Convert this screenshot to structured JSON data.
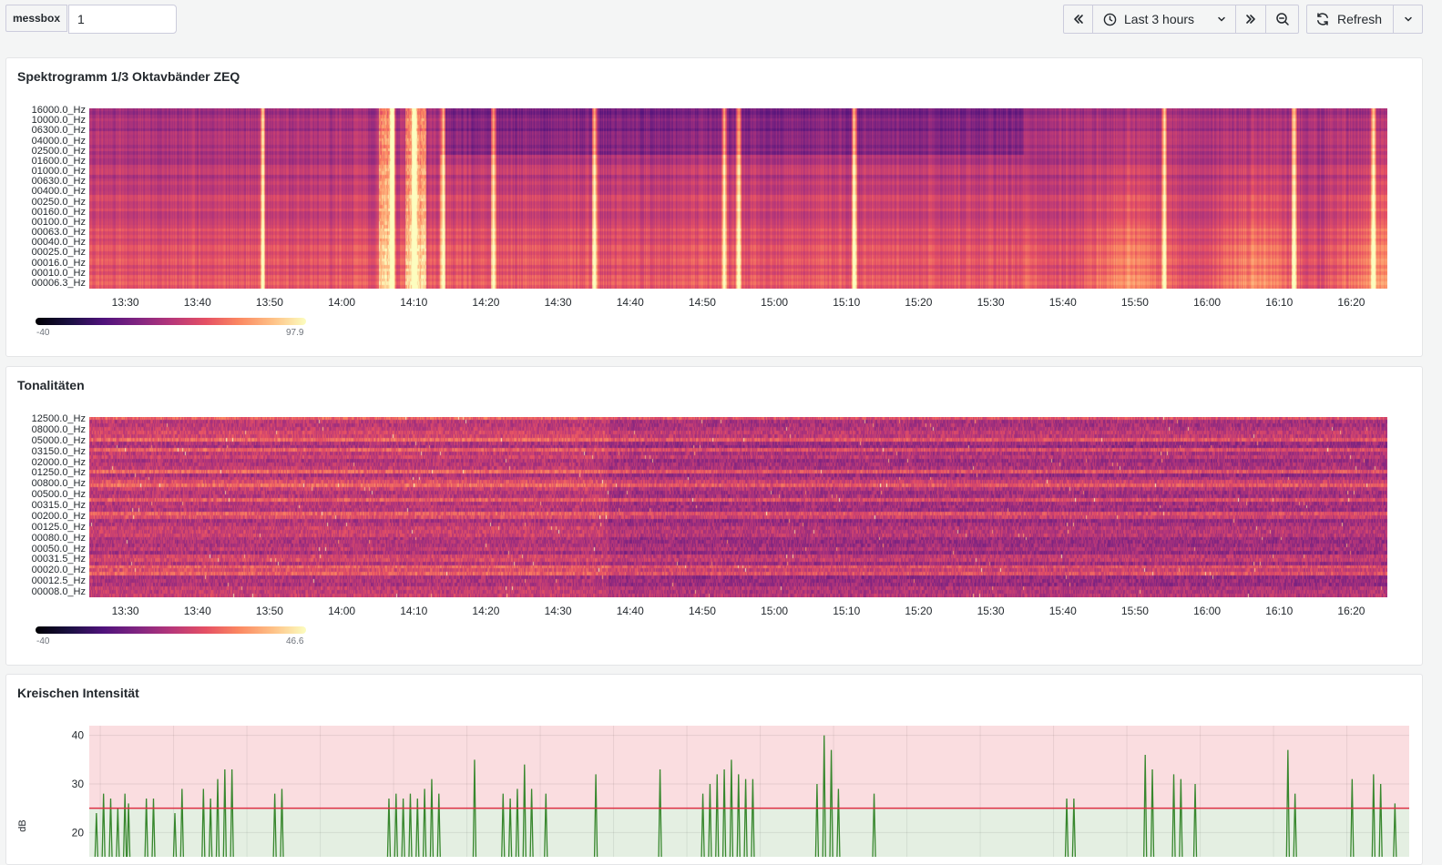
{
  "toolbar": {
    "variable_label": "messbox",
    "variable_value": "1",
    "time_range_label": "Last 3 hours",
    "refresh_label": "Refresh",
    "icons": {
      "back": "chevrons-left-icon",
      "clock": "clock-icon",
      "dropdown": "chevron-down-icon",
      "forward": "chevrons-right-icon",
      "zoom_out": "zoom-out-icon",
      "refresh": "refresh-icon"
    }
  },
  "panels": {
    "spectrogram": {
      "title": "Spektrogramm 1/3 Oktavbänder ZEQ",
      "y_labels": [
        "16000.0_Hz",
        "10000.0_Hz",
        "06300.0_Hz",
        "04000.0_Hz",
        "02500.0_Hz",
        "01600.0_Hz",
        "01000.0_Hz",
        "00630.0_Hz",
        "00400.0_Hz",
        "00250.0_Hz",
        "00160.0_Hz",
        "00100.0_Hz",
        "00063.0_Hz",
        "00040.0_Hz",
        "00025.0_Hz",
        "00016.0_Hz",
        "00010.0_Hz",
        "00006.3_Hz"
      ],
      "x_labels": [
        "13:30",
        "13:40",
        "13:50",
        "14:00",
        "14:10",
        "14:20",
        "14:30",
        "14:40",
        "14:50",
        "15:00",
        "15:10",
        "15:20",
        "15:30",
        "15:40",
        "15:50",
        "16:00",
        "16:10",
        "16:20"
      ],
      "legend_min": "-40",
      "legend_max": "97.9"
    },
    "tonality": {
      "title": "Tonalitäten",
      "y_labels": [
        "12500.0_Hz",
        "08000.0_Hz",
        "05000.0_Hz",
        "03150.0_Hz",
        "02000.0_Hz",
        "01250.0_Hz",
        "00800.0_Hz",
        "00500.0_Hz",
        "00315.0_Hz",
        "00200.0_Hz",
        "00125.0_Hz",
        "00080.0_Hz",
        "00050.0_Hz",
        "00031.5_Hz",
        "00020.0_Hz",
        "00012.5_Hz",
        "00008.0_Hz"
      ],
      "x_labels": [
        "13:30",
        "13:40",
        "13:50",
        "14:00",
        "14:10",
        "14:20",
        "14:30",
        "14:40",
        "14:50",
        "15:00",
        "15:10",
        "15:20",
        "15:30",
        "15:40",
        "15:50",
        "16:00",
        "16:10",
        "16:20"
      ],
      "legend_min": "-40",
      "legend_max": "46.6"
    },
    "kreischen": {
      "title": "Kreischen Intensität",
      "y_axis_label": "dB",
      "y_ticks": [
        "40",
        "30",
        "20"
      ]
    }
  },
  "chart_data": [
    {
      "type": "heatmap",
      "title": "Spektrogramm 1/3 Oktavbänder ZEQ",
      "x_range": [
        "13:25",
        "16:25"
      ],
      "color_scale": {
        "min": -40,
        "max": 97.9,
        "scheme": "magma"
      },
      "y_categories": [
        "16000.0_Hz",
        "10000.0_Hz",
        "06300.0_Hz",
        "04000.0_Hz",
        "02500.0_Hz",
        "01600.0_Hz",
        "01000.0_Hz",
        "00630.0_Hz",
        "00400.0_Hz",
        "00250.0_Hz",
        "00160.0_Hz",
        "00100.0_Hz",
        "00063.0_Hz",
        "00040.0_Hz",
        "00025.0_Hz",
        "00016.0_Hz",
        "00010.0_Hz",
        "00006.3_Hz"
      ],
      "loud_events": [
        "13:49",
        "14:07",
        "14:10",
        "14:14",
        "14:21",
        "14:35",
        "14:53",
        "14:55",
        "15:11",
        "15:54",
        "16:12",
        "16:23"
      ]
    },
    {
      "type": "heatmap",
      "title": "Tonalitäten",
      "x_range": [
        "13:25",
        "16:25"
      ],
      "color_scale": {
        "min": -40,
        "max": 46.6,
        "scheme": "magma"
      },
      "y_categories": [
        "12500.0_Hz",
        "08000.0_Hz",
        "05000.0_Hz",
        "03150.0_Hz",
        "02000.0_Hz",
        "01250.0_Hz",
        "00800.0_Hz",
        "00500.0_Hz",
        "00315.0_Hz",
        "00200.0_Hz",
        "00125.0_Hz",
        "00080.0_Hz",
        "00050.0_Hz",
        "00031.5_Hz",
        "00020.0_Hz",
        "00012.5_Hz",
        "00008.0_Hz"
      ]
    },
    {
      "type": "line",
      "title": "Kreischen Intensität",
      "ylabel": "dB",
      "ylim": [
        15,
        42
      ],
      "x_range": [
        "13:25",
        "16:30"
      ],
      "threshold": 25,
      "colors": {
        "series": "#37872d",
        "threshold": "#e02f44",
        "above": "#fadde0",
        "below": "#e4efe2"
      },
      "spikes": [
        {
          "t": "13:26",
          "v": 24
        },
        {
          "t": "13:27",
          "v": 28
        },
        {
          "t": "13:28",
          "v": 27
        },
        {
          "t": "13:29",
          "v": 25
        },
        {
          "t": "13:30",
          "v": 28
        },
        {
          "t": "13:30.5",
          "v": 26
        },
        {
          "t": "13:33",
          "v": 27
        },
        {
          "t": "13:34",
          "v": 27
        },
        {
          "t": "13:37",
          "v": 24
        },
        {
          "t": "13:38",
          "v": 29
        },
        {
          "t": "13:41",
          "v": 29
        },
        {
          "t": "13:42",
          "v": 27
        },
        {
          "t": "13:43",
          "v": 31
        },
        {
          "t": "13:44",
          "v": 33
        },
        {
          "t": "13:45",
          "v": 33
        },
        {
          "t": "13:51",
          "v": 28
        },
        {
          "t": "13:52",
          "v": 29
        },
        {
          "t": "14:07",
          "v": 27
        },
        {
          "t": "14:08",
          "v": 28
        },
        {
          "t": "14:09",
          "v": 27
        },
        {
          "t": "14:10",
          "v": 28
        },
        {
          "t": "14:11",
          "v": 27
        },
        {
          "t": "14:12",
          "v": 29
        },
        {
          "t": "14:13",
          "v": 31
        },
        {
          "t": "14:14",
          "v": 28
        },
        {
          "t": "14:19",
          "v": 35
        },
        {
          "t": "14:23",
          "v": 28
        },
        {
          "t": "14:24",
          "v": 27
        },
        {
          "t": "14:25",
          "v": 29
        },
        {
          "t": "14:26",
          "v": 34
        },
        {
          "t": "14:27",
          "v": 29
        },
        {
          "t": "14:29",
          "v": 28
        },
        {
          "t": "14:36",
          "v": 32
        },
        {
          "t": "14:45",
          "v": 33
        },
        {
          "t": "14:51",
          "v": 28
        },
        {
          "t": "14:52",
          "v": 30
        },
        {
          "t": "14:53",
          "v": 32
        },
        {
          "t": "14:54",
          "v": 33
        },
        {
          "t": "14:55",
          "v": 35
        },
        {
          "t": "14:56",
          "v": 32
        },
        {
          "t": "14:57",
          "v": 31
        },
        {
          "t": "14:58",
          "v": 31
        },
        {
          "t": "15:07",
          "v": 30
        },
        {
          "t": "15:08",
          "v": 40
        },
        {
          "t": "15:09",
          "v": 37
        },
        {
          "t": "15:10",
          "v": 29
        },
        {
          "t": "15:15",
          "v": 28
        },
        {
          "t": "15:42",
          "v": 27
        },
        {
          "t": "15:43",
          "v": 27
        },
        {
          "t": "15:53",
          "v": 36
        },
        {
          "t": "15:54",
          "v": 33
        },
        {
          "t": "15:57",
          "v": 32
        },
        {
          "t": "15:58",
          "v": 31
        },
        {
          "t": "16:00",
          "v": 30
        },
        {
          "t": "16:13",
          "v": 37
        },
        {
          "t": "16:14",
          "v": 28
        },
        {
          "t": "16:22",
          "v": 31
        },
        {
          "t": "16:25",
          "v": 32
        },
        {
          "t": "16:26",
          "v": 30
        },
        {
          "t": "16:28",
          "v": 26
        }
      ]
    }
  ]
}
